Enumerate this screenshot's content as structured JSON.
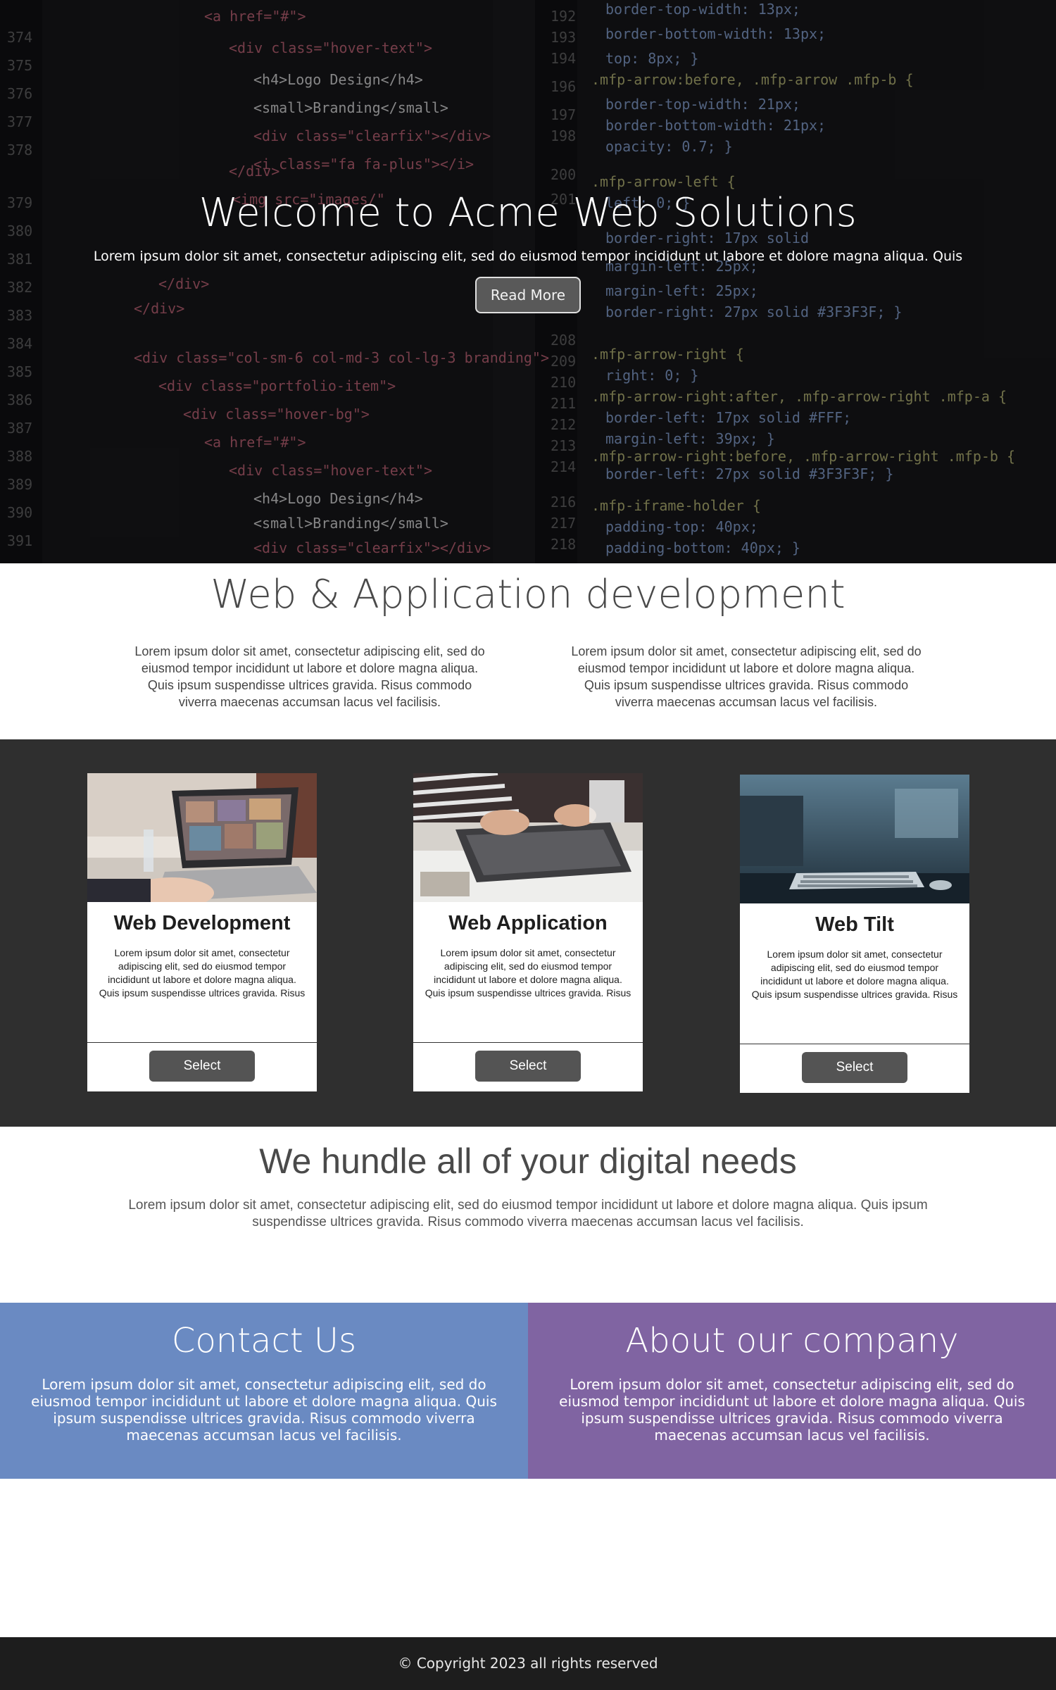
{
  "hero": {
    "title": "Welcome to Acme Web Solutions",
    "text": "Lorem ipsum dolor sit amet, consectetur adipiscing elit, sed do eiusmod tempor incididunt ut labore et dolore magna aliqua. Quis",
    "button_label": "Read More"
  },
  "development": {
    "title": "Web & Application development",
    "columns": [
      "Lorem ipsum dolor sit amet, consectetur adipiscing elit, sed do eiusmod tempor incididunt ut labore et dolore magna aliqua. Quis ipsum suspendisse ultrices gravida. Risus commodo viverra maecenas accumsan lacus vel facilisis.",
      "Lorem ipsum dolor sit amet, consectetur adipiscing elit, sed do eiusmod tempor incididunt ut labore et dolore magna aliqua. Quis ipsum suspendisse ultrices gravida. Risus commodo viverra maecenas accumsan lacus vel facilisis."
    ]
  },
  "cards": [
    {
      "title": "Web Development",
      "text": "Lorem ipsum dolor sit amet, consectetur adipiscing elit, sed do eiusmod tempor incididunt ut labore et dolore magna aliqua. Quis ipsum suspendisse ultrices gravida. Risus",
      "button_label": "Select",
      "image": "laptop-photo"
    },
    {
      "title": "Web Application",
      "text": "Lorem ipsum dolor sit amet, consectetur adipiscing elit, sed do eiusmod tempor incididunt ut labore et dolore magna aliqua. Quis ipsum suspendisse ultrices gravida. Risus",
      "button_label": "Select",
      "image": "typing-laptop-photo"
    },
    {
      "title": "Web Tilt",
      "text": "Lorem ipsum dolor sit amet, consectetur adipiscing elit, sed do eiusmod tempor incididunt ut labore et dolore magna aliqua. Quis ipsum suspendisse ultrices gravida. Risus",
      "button_label": "Select",
      "image": "keyboard-desk-photo"
    }
  ],
  "digital": {
    "title": "We hundle all of your digital needs",
    "text": "Lorem ipsum dolor sit amet, consectetur adipiscing elit, sed do eiusmod tempor incididunt ut labore et dolore magna aliqua. Quis ipsum suspendisse ultrices gravida. Risus commodo viverra maecenas accumsan lacus vel facilisis."
  },
  "contact": {
    "title": "Contact Us",
    "text": "Lorem ipsum dolor sit amet, consectetur adipiscing elit, sed do eiusmod tempor incididunt ut labore et dolore magna aliqua. Quis ipsum suspendisse ultrices gravida. Risus commodo viverra maecenas accumsan lacus vel facilisis."
  },
  "about": {
    "title": "About our company",
    "text": "Lorem ipsum dolor sit amet, consectetur adipiscing elit, sed do eiusmod tempor incididunt ut labore et dolore magna aliqua. Quis ipsum suspendisse ultrices gravida. Risus commodo viverra maecenas accumsan lacus vel facilisis."
  },
  "footer": {
    "copyright": "© Copyright 2023 all rights reserved"
  },
  "colors": {
    "hero_bg": "#0f0f10",
    "cards_bg": "#2f2f2f",
    "contact_bg": "#6a8ac2",
    "about_bg": "#8064a2",
    "footer_bg": "#1d1d1d",
    "button_bg": "#545454"
  }
}
